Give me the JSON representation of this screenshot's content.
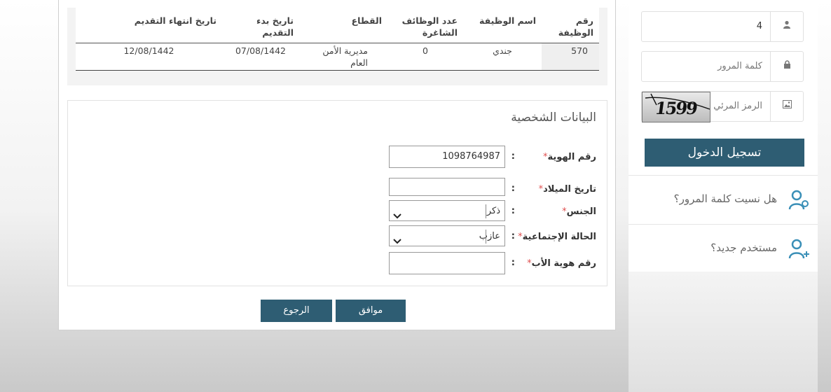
{
  "jobs_table": {
    "headers": [
      "رقم الوظيفة",
      "اسم الوظيفة",
      "عدد الوظائف الشاغرة",
      "القطاع",
      "تاريخ بدء التقديم",
      "تاريخ انتهاء التقديم"
    ],
    "rows": [
      {
        "job_number": "570",
        "job_name": "جندي",
        "vacancies": "0",
        "sector": "مديرية الأمن العام",
        "start_date": "07/08/1442",
        "end_date": "12/08/1442"
      }
    ]
  },
  "personal": {
    "title": "البيانات الشخصية",
    "fields": [
      {
        "label": "رقم الهوية",
        "value": "1098764987",
        "type": "text"
      },
      {
        "label": "تاريخ الميلاد",
        "value": "",
        "type": "text"
      },
      {
        "label": "الجنس",
        "value": "ذكر",
        "type": "select"
      },
      {
        "label": "الحالة الإجتماعية",
        "value": "عازب",
        "type": "select"
      },
      {
        "label": "رقم هوية الأب",
        "value": "",
        "type": "text"
      }
    ],
    "required_mark": "*",
    "colon": ":"
  },
  "actions": {
    "ok_label": "موافق",
    "back_label": "الرجوع"
  },
  "sidebar": {
    "username_value": "4",
    "password_placeholder": "كلمة المرور",
    "captcha_placeholder": "الرمز المرئي",
    "captcha_text": "1599",
    "login_label": "تسجيل الدخول",
    "forgot_password": "هل نسيت كلمة المرور؟",
    "new_user": "مستخدم جديد؟"
  },
  "colors": {
    "primary": "#2e5d73",
    "required": "#e05050",
    "accent_icon": "#3a8fb7"
  }
}
